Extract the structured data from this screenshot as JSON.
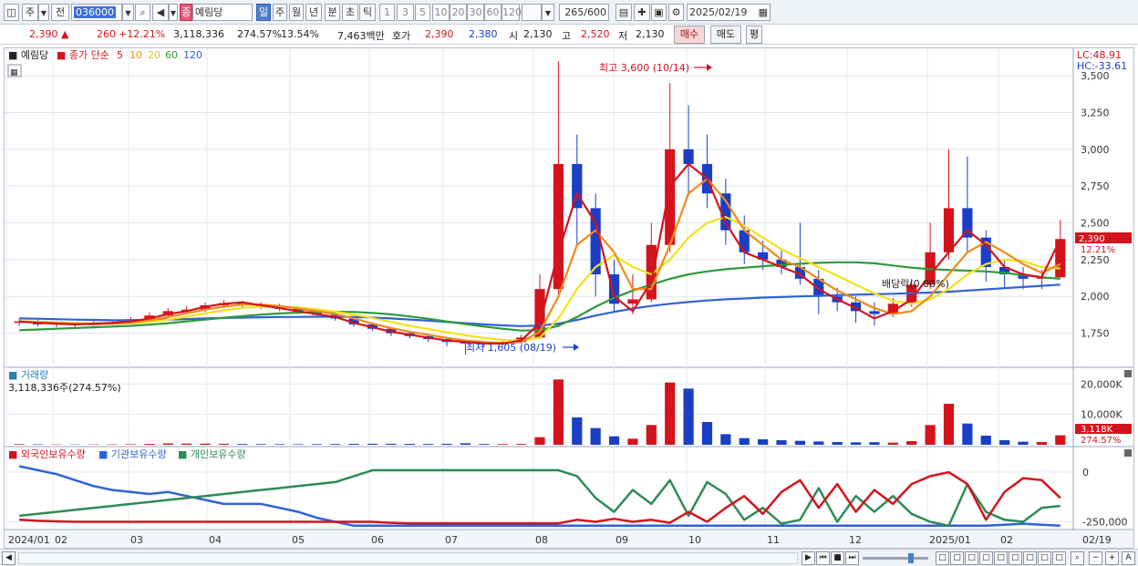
{
  "toolbar": {
    "market": "주",
    "prev": "전",
    "code": "036000",
    "name": "예림당",
    "name_badge": "종",
    "periods": [
      "일",
      "주",
      "월",
      "년",
      "분",
      "초",
      "틱"
    ],
    "active_period": "일",
    "minutes": [
      "1",
      "3",
      "5",
      "10",
      "20",
      "30",
      "60",
      "120"
    ],
    "count": "265",
    "count_total": "/600",
    "date": "2025/02/19"
  },
  "quote": {
    "price": "2,390",
    "change": "260",
    "change_pct": "+12.21%",
    "volume": "3,118,336",
    "volume_ratio": "274.57%",
    "turnover": "13.54%",
    "amount": "7,463백만",
    "hoga_label": "호가",
    "ask": "2,390",
    "bid": "2,380",
    "open_label": "시",
    "open": "2,130",
    "high_label": "고",
    "high": "2,520",
    "low_label": "저",
    "low": "2,130",
    "buy_btn": "매수",
    "sell_btn": "매도",
    "eval_btn": "평"
  },
  "legend": {
    "stock": "예림당",
    "ma_title": "종가 단순",
    "ma_periods": [
      "5",
      "10",
      "20",
      "60",
      "120"
    ],
    "lc": "LC:48.91",
    "hc": "HC:-33.61",
    "volume_title": "거래량",
    "volume_value": "3,118,336주(274.57%)",
    "holdings": [
      "외국인보유수량",
      "기관보유수량",
      "개인보유수량"
    ]
  },
  "annotations": {
    "high": "최고 3,600 (10/14)",
    "low": "최저 1,605 (08/19)",
    "dividend": "배당락(0.00%)"
  },
  "right_labels": {
    "price": "2,390",
    "pct": "12.21%",
    "vol": "3,118K",
    "vol_pct": "274.57%"
  },
  "colors": {
    "up": "#d4141d",
    "down": "#1b3fc4",
    "ma5": "#d4141d",
    "ma10": "#f08a1a",
    "ma20": "#f2e21a",
    "ma60": "#2e9a3c",
    "ma120": "#2f62d8",
    "foreign": "#d4141d",
    "institution": "#2f62d8",
    "individual": "#2e8b57"
  },
  "chart_data": {
    "type": "candlestick",
    "price_axis": [
      "3,500",
      "3,250",
      "3,000",
      "2,750",
      "2,500",
      "2,250",
      "2,000",
      "1,750"
    ],
    "price_ticks": [
      3500,
      3250,
      3000,
      2750,
      2500,
      2250,
      2000,
      1750
    ],
    "ylim": [
      1580,
      3600
    ],
    "volume_axis": [
      "20,000K",
      "10,000K"
    ],
    "volume_ticks": [
      20000,
      10000
    ],
    "holdings_axis": [
      "0",
      "-250,000"
    ],
    "x_labels": [
      "2024/01",
      "02",
      "03",
      "04",
      "05",
      "06",
      "07",
      "08",
      "09",
      "10",
      "11",
      "12",
      "2025/01",
      "02",
      "02/19"
    ],
    "ma5": [
      1830,
      1820,
      1815,
      1810,
      1815,
      1820,
      1830,
      1850,
      1880,
      1900,
      1930,
      1950,
      1960,
      1940,
      1920,
      1900,
      1880,
      1860,
      1820,
      1790,
      1760,
      1740,
      1720,
      1700,
      1690,
      1680,
      1680,
      1700,
      1820,
      2300,
      2700,
      2500,
      2000,
      1900,
      2100,
      2750,
      2900,
      2800,
      2500,
      2300,
      2250,
      2200,
      2150,
      2050,
      1980,
      1920,
      1850,
      1900,
      1980,
      2150,
      2300,
      2450,
      2350,
      2200,
      2150,
      2130,
      2390
    ],
    "ma10": [
      1830,
      1825,
      1820,
      1815,
      1812,
      1815,
      1822,
      1838,
      1860,
      1885,
      1910,
      1930,
      1945,
      1945,
      1935,
      1918,
      1900,
      1880,
      1850,
      1815,
      1785,
      1760,
      1740,
      1718,
      1700,
      1690,
      1684,
      1690,
      1760,
      2000,
      2350,
      2450,
      2300,
      2050,
      2050,
      2350,
      2700,
      2800,
      2650,
      2450,
      2350,
      2250,
      2200,
      2120,
      2040,
      1980,
      1920,
      1880,
      1900,
      2000,
      2150,
      2300,
      2370,
      2300,
      2220,
      2160,
      2220
    ],
    "ma20": [
      1830,
      1828,
      1824,
      1820,
      1816,
      1815,
      1818,
      1826,
      1842,
      1862,
      1885,
      1905,
      1922,
      1930,
      1930,
      1925,
      1912,
      1896,
      1876,
      1852,
      1826,
      1800,
      1778,
      1756,
      1736,
      1718,
      1704,
      1700,
      1720,
      1850,
      2050,
      2200,
      2280,
      2200,
      2150,
      2250,
      2400,
      2500,
      2540,
      2480,
      2400,
      2320,
      2260,
      2200,
      2140,
      2080,
      2020,
      1970,
      1950,
      1980,
      2050,
      2150,
      2220,
      2250,
      2240,
      2200,
      2190
    ],
    "ma60": [
      1770,
      1775,
      1780,
      1785,
      1790,
      1795,
      1800,
      1808,
      1818,
      1830,
      1842,
      1855,
      1866,
      1876,
      1884,
      1890,
      1894,
      1896,
      1894,
      1888,
      1878,
      1864,
      1848,
      1830,
      1812,
      1795,
      1780,
      1768,
      1770,
      1800,
      1860,
      1930,
      1990,
      2040,
      2080,
      2120,
      2150,
      2170,
      2185,
      2195,
      2205,
      2215,
      2222,
      2228,
      2232,
      2232,
      2225,
      2210,
      2195,
      2185,
      2180,
      2175,
      2170,
      2160,
      2145,
      2130,
      2120
    ],
    "ma120": [
      1850,
      1848,
      1845,
      1842,
      1840,
      1838,
      1838,
      1840,
      1843,
      1846,
      1850,
      1853,
      1856,
      1858,
      1860,
      1861,
      1862,
      1862,
      1860,
      1856,
      1850,
      1843,
      1835,
      1826,
      1818,
      1810,
      1803,
      1798,
      1802,
      1815,
      1840,
      1870,
      1895,
      1918,
      1935,
      1950,
      1962,
      1972,
      1980,
      1986,
      1992,
      1996,
      2000,
      2004,
      2008,
      2012,
      2015,
      2018,
      2022,
      2026,
      2032,
      2040,
      2048,
      2056,
      2064,
      2072,
      2080
    ],
    "candles": [
      {
        "o": 1820,
        "c": 1830,
        "h": 1850,
        "l": 1800
      },
      {
        "o": 1830,
        "c": 1810,
        "h": 1845,
        "l": 1795
      },
      {
        "o": 1810,
        "c": 1815,
        "h": 1830,
        "l": 1790
      },
      {
        "o": 1815,
        "c": 1805,
        "h": 1825,
        "l": 1790
      },
      {
        "o": 1805,
        "c": 1820,
        "h": 1835,
        "l": 1800
      },
      {
        "o": 1820,
        "c": 1825,
        "h": 1840,
        "l": 1805
      },
      {
        "o": 1825,
        "c": 1845,
        "h": 1860,
        "l": 1815
      },
      {
        "o": 1845,
        "c": 1870,
        "h": 1890,
        "l": 1835
      },
      {
        "o": 1870,
        "c": 1900,
        "h": 1920,
        "l": 1860
      },
      {
        "o": 1900,
        "c": 1910,
        "h": 1935,
        "l": 1880
      },
      {
        "o": 1910,
        "c": 1940,
        "h": 1960,
        "l": 1895
      },
      {
        "o": 1940,
        "c": 1955,
        "h": 1975,
        "l": 1920
      },
      {
        "o": 1955,
        "c": 1945,
        "h": 1970,
        "l": 1925
      },
      {
        "o": 1945,
        "c": 1935,
        "h": 1960,
        "l": 1915
      },
      {
        "o": 1935,
        "c": 1915,
        "h": 1950,
        "l": 1900
      },
      {
        "o": 1915,
        "c": 1895,
        "h": 1930,
        "l": 1880
      },
      {
        "o": 1895,
        "c": 1875,
        "h": 1910,
        "l": 1860
      },
      {
        "o": 1875,
        "c": 1850,
        "h": 1890,
        "l": 1835
      },
      {
        "o": 1850,
        "c": 1810,
        "h": 1860,
        "l": 1795
      },
      {
        "o": 1810,
        "c": 1780,
        "h": 1825,
        "l": 1765
      },
      {
        "o": 1780,
        "c": 1750,
        "h": 1790,
        "l": 1730
      },
      {
        "o": 1750,
        "c": 1730,
        "h": 1765,
        "l": 1715
      },
      {
        "o": 1730,
        "c": 1710,
        "h": 1745,
        "l": 1690
      },
      {
        "o": 1710,
        "c": 1690,
        "h": 1720,
        "l": 1660
      },
      {
        "o": 1690,
        "c": 1680,
        "h": 1705,
        "l": 1605
      },
      {
        "o": 1680,
        "c": 1675,
        "h": 1695,
        "l": 1655
      },
      {
        "o": 1675,
        "c": 1690,
        "h": 1705,
        "l": 1660
      },
      {
        "o": 1690,
        "c": 1720,
        "h": 1740,
        "l": 1680
      },
      {
        "o": 1720,
        "c": 2050,
        "h": 2150,
        "l": 1710
      },
      {
        "o": 2050,
        "c": 2900,
        "h": 3600,
        "l": 2000
      },
      {
        "o": 2900,
        "c": 2600,
        "h": 3100,
        "l": 2350
      },
      {
        "o": 2600,
        "c": 2150,
        "h": 2700,
        "l": 2000
      },
      {
        "o": 2150,
        "c": 1950,
        "h": 2250,
        "l": 1900
      },
      {
        "o": 1950,
        "c": 1980,
        "h": 2150,
        "l": 1880
      },
      {
        "o": 1980,
        "c": 2350,
        "h": 2500,
        "l": 1960
      },
      {
        "o": 2350,
        "c": 3000,
        "h": 3450,
        "l": 2300
      },
      {
        "o": 3000,
        "c": 2900,
        "h": 3300,
        "l": 2700
      },
      {
        "o": 2900,
        "c": 2700,
        "h": 3100,
        "l": 2600
      },
      {
        "o": 2700,
        "c": 2450,
        "h": 2800,
        "l": 2350
      },
      {
        "o": 2450,
        "c": 2300,
        "h": 2550,
        "l": 2220
      },
      {
        "o": 2300,
        "c": 2250,
        "h": 2380,
        "l": 2180
      },
      {
        "o": 2250,
        "c": 2200,
        "h": 2320,
        "l": 2150
      },
      {
        "o": 2200,
        "c": 2120,
        "h": 2500,
        "l": 2080
      },
      {
        "o": 2120,
        "c": 2000,
        "h": 2180,
        "l": 1880
      },
      {
        "o": 2000,
        "c": 1960,
        "h": 2060,
        "l": 1900
      },
      {
        "o": 1960,
        "c": 1900,
        "h": 2000,
        "l": 1820
      },
      {
        "o": 1900,
        "c": 1880,
        "h": 1960,
        "l": 1800
      },
      {
        "o": 1880,
        "c": 1950,
        "h": 1990,
        "l": 1860
      },
      {
        "o": 1950,
        "c": 2080,
        "h": 2120,
        "l": 1930
      },
      {
        "o": 2080,
        "c": 2300,
        "h": 2500,
        "l": 2050
      },
      {
        "o": 2300,
        "c": 2600,
        "h": 3000,
        "l": 2250
      },
      {
        "o": 2600,
        "c": 2400,
        "h": 2950,
        "l": 2300
      },
      {
        "o": 2400,
        "c": 2200,
        "h": 2450,
        "l": 2100
      },
      {
        "o": 2200,
        "c": 2150,
        "h": 2250,
        "l": 2060
      },
      {
        "o": 2150,
        "c": 2120,
        "h": 2200,
        "l": 2050
      },
      {
        "o": 2120,
        "c": 2130,
        "h": 2180,
        "l": 2050
      },
      {
        "o": 2130,
        "c": 2390,
        "h": 2520,
        "l": 2130
      }
    ],
    "volume": [
      200,
      150,
      120,
      100,
      110,
      130,
      180,
      300,
      450,
      400,
      380,
      320,
      260,
      220,
      200,
      180,
      210,
      240,
      300,
      320,
      340,
      300,
      280,
      330,
      500,
      260,
      240,
      260,
      2500,
      21500,
      9000,
      5500,
      2800,
      2000,
      6500,
      20500,
      18500,
      7500,
      3500,
      2200,
      1800,
      1500,
      1300,
      1100,
      900,
      800,
      850,
      700,
      1200,
      6500,
      13500,
      7000,
      3000,
      1500,
      1000,
      900,
      3118
    ],
    "holdings": {
      "foreign": [
        -240000,
        -245000,
        -248000,
        -250000,
        -250000,
        -250000,
        -250000,
        -250000,
        -250000,
        -250000,
        -250000,
        -250000,
        -250000,
        -250000,
        -250000,
        -250000,
        -250000,
        -250000,
        -250000,
        -250000,
        -255000,
        -258000,
        -258000,
        -258000,
        -258000,
        -258000,
        -258000,
        -258000,
        -258000,
        -258000,
        -240000,
        -250000,
        -235000,
        -250000,
        -240000,
        -255000,
        -200000,
        -250000,
        -180000,
        -120000,
        -210000,
        -100000,
        -40000,
        -180000,
        -60000,
        -200000,
        -90000,
        -160000,
        -60000,
        -20000,
        0,
        -60000,
        -240000,
        -100000,
        -30000,
        -40000,
        -130000
      ],
      "institution": [
        30000,
        10000,
        -10000,
        -40000,
        -70000,
        -90000,
        -100000,
        -110000,
        -100000,
        -120000,
        -140000,
        -160000,
        -160000,
        -160000,
        -180000,
        -200000,
        -230000,
        -250000,
        -270000,
        -270000,
        -270000,
        -270000,
        -270000,
        -270000,
        -270000,
        -270000,
        -270000,
        -270000,
        -270000,
        -270000,
        -270000,
        -270000,
        -270000,
        -270000,
        -270000,
        -270000,
        -270000,
        -270000,
        -270000,
        -270000,
        -270000,
        -270000,
        -270000,
        -270000,
        -270000,
        -270000,
        -270000,
        -270000,
        -270000,
        -270000,
        -270000,
        -270000,
        -270000,
        -265000,
        -260000,
        -265000,
        -270000
      ],
      "individual": [
        -220000,
        -210000,
        -200000,
        -190000,
        -180000,
        -170000,
        -160000,
        -150000,
        -140000,
        -130000,
        -120000,
        -110000,
        -100000,
        -90000,
        -80000,
        -70000,
        -60000,
        -50000,
        -20000,
        10000,
        10000,
        10000,
        10000,
        10000,
        10000,
        10000,
        10000,
        10000,
        10000,
        10000,
        -20000,
        -130000,
        -200000,
        -90000,
        -160000,
        -40000,
        -220000,
        -50000,
        -110000,
        -240000,
        -180000,
        -260000,
        -240000,
        -80000,
        -250000,
        -120000,
        -200000,
        -120000,
        -210000,
        -250000,
        -270000,
        -60000,
        -200000,
        -240000,
        -250000,
        -180000,
        -170000
      ]
    }
  }
}
